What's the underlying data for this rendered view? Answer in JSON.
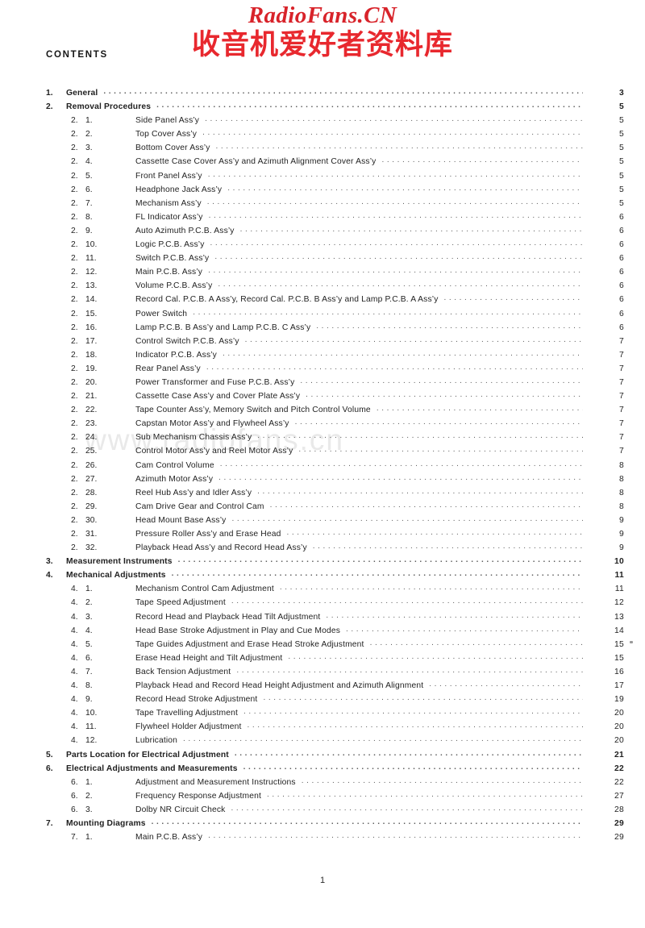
{
  "watermark": {
    "latin": "RadioFans.CN",
    "cjk": "收音机爱好者资料库",
    "faint": "www.radiofans.cn",
    "latin_color": "#d8232a",
    "cjk_color": "#e8282e",
    "faint_color": "#e9e9e9"
  },
  "heading": "CONTENTS",
  "folio": "1",
  "toc": [
    {
      "level": 1,
      "a": "1.",
      "b": "",
      "label": "General",
      "page": "3"
    },
    {
      "level": 1,
      "a": "2.",
      "b": "",
      "label": "Removal Procedures",
      "page": "5"
    },
    {
      "level": 2,
      "a": "2.",
      "b": "1.",
      "label": "Side Panel Ass’y",
      "page": "5"
    },
    {
      "level": 2,
      "a": "2.",
      "b": "2.",
      "label": "Top Cover Ass’y",
      "page": "5"
    },
    {
      "level": 2,
      "a": "2.",
      "b": "3.",
      "label": "Bottom Cover Ass’y",
      "page": "5"
    },
    {
      "level": 2,
      "a": "2.",
      "b": "4.",
      "label": "Cassette Case Cover Ass’y and Azimuth Alignment Cover Ass’y",
      "page": "5"
    },
    {
      "level": 2,
      "a": "2.",
      "b": "5.",
      "label": "Front Panel Ass’y",
      "page": "5"
    },
    {
      "level": 2,
      "a": "2.",
      "b": "6.",
      "label": "Headphone Jack Ass’y",
      "page": "5"
    },
    {
      "level": 2,
      "a": "2.",
      "b": "7.",
      "label": "Mechanism Ass’y",
      "page": "5"
    },
    {
      "level": 2,
      "a": "2.",
      "b": "8.",
      "label": "FL Indicator Ass’y",
      "page": "6"
    },
    {
      "level": 2,
      "a": "2.",
      "b": "9.",
      "label": "Auto Azimuth P.C.B. Ass’y",
      "page": "6"
    },
    {
      "level": 2,
      "a": "2.",
      "b": "10.",
      "label": "Logic P.C.B. Ass’y",
      "page": "6"
    },
    {
      "level": 2,
      "a": "2.",
      "b": "11.",
      "label": "Switch P.C.B. Ass’y",
      "page": "6"
    },
    {
      "level": 2,
      "a": "2.",
      "b": "12.",
      "label": "Main P.C.B. Ass’y",
      "page": "6"
    },
    {
      "level": 2,
      "a": "2.",
      "b": "13.",
      "label": "Volume P.C.B. Ass’y",
      "page": "6"
    },
    {
      "level": 2,
      "a": "2.",
      "b": "14.",
      "label": "Record Cal. P.C.B. A Ass’y, Record Cal. P.C.B. B Ass’y and Lamp P.C.B. A Ass’y",
      "page": "6"
    },
    {
      "level": 2,
      "a": "2.",
      "b": "15.",
      "label": "Power Switch",
      "page": "6"
    },
    {
      "level": 2,
      "a": "2.",
      "b": "16.",
      "label": "Lamp P.C.B. B Ass’y and Lamp P.C.B. C Ass’y",
      "page": "6"
    },
    {
      "level": 2,
      "a": "2.",
      "b": "17.",
      "label": "Control Switch P.C.B. Ass’y",
      "page": "7"
    },
    {
      "level": 2,
      "a": "2.",
      "b": "18.",
      "label": "Indicator P.C.B. Ass’y",
      "page": "7"
    },
    {
      "level": 2,
      "a": "2.",
      "b": "19.",
      "label": "Rear Panel Ass’y",
      "page": "7"
    },
    {
      "level": 2,
      "a": "2.",
      "b": "20.",
      "label": "Power Transformer and Fuse P.C.B. Ass’y",
      "page": "7"
    },
    {
      "level": 2,
      "a": "2.",
      "b": "21.",
      "label": "Cassette Case Ass’y and Cover Plate Ass’y",
      "page": "7"
    },
    {
      "level": 2,
      "a": "2.",
      "b": "22.",
      "label": "Tape Counter Ass’y, Memory Switch and Pitch Control Volume",
      "page": "7"
    },
    {
      "level": 2,
      "a": "2.",
      "b": "23.",
      "label": "Capstan Motor Ass’y and Flywheel Ass’y",
      "page": "7"
    },
    {
      "level": 2,
      "a": "2.",
      "b": "24.",
      "label": "Sub Mechanism Chassis Ass’y",
      "page": "7"
    },
    {
      "level": 2,
      "a": "2.",
      "b": "25.",
      "label": "Control Motor Ass’y and Reel Motor Ass’y",
      "page": "7"
    },
    {
      "level": 2,
      "a": "2.",
      "b": "26.",
      "label": "Cam Control Volume",
      "page": "8"
    },
    {
      "level": 2,
      "a": "2.",
      "b": "27.",
      "label": "Azimuth Motor Ass’y",
      "page": "8"
    },
    {
      "level": 2,
      "a": "2.",
      "b": "28.",
      "label": "Reel Hub Ass’y and Idler Ass’y",
      "page": "8"
    },
    {
      "level": 2,
      "a": "2.",
      "b": "29.",
      "label": "Cam Drive Gear and Control Cam",
      "page": "8"
    },
    {
      "level": 2,
      "a": "2.",
      "b": "30.",
      "label": "Head Mount Base Ass’y",
      "page": "9"
    },
    {
      "level": 2,
      "a": "2.",
      "b": "31.",
      "label": "Pressure Roller Ass’y and Erase Head",
      "page": "9"
    },
    {
      "level": 2,
      "a": "2.",
      "b": "32.",
      "label": "Playback Head Ass’y and Record Head Ass’y",
      "page": "9"
    },
    {
      "level": 1,
      "a": "3.",
      "b": "",
      "label": "Measurement Instruments",
      "page": "10"
    },
    {
      "level": 1,
      "a": "4.",
      "b": "",
      "label": "Mechanical Adjustments",
      "page": "11"
    },
    {
      "level": 2,
      "a": "4.",
      "b": "1.",
      "label": "Mechanism Control Cam Adjustment",
      "page": "11"
    },
    {
      "level": 2,
      "a": "4.",
      "b": "2.",
      "label": "Tape Speed Adjustment",
      "page": "12"
    },
    {
      "level": 2,
      "a": "4.",
      "b": "3.",
      "label": "Record Head and Playback Head Tilt Adjustment",
      "page": "13"
    },
    {
      "level": 2,
      "a": "4.",
      "b": "4.",
      "label": "Head Base Stroke Adjustment in Play and Cue Modes",
      "page": "14"
    },
    {
      "level": 2,
      "a": "4.",
      "b": "5.",
      "label": "Tape Guides Adjustment and Erase Head Stroke Adjustment",
      "page": "15"
    },
    {
      "level": 2,
      "a": "4.",
      "b": "6.",
      "label": "Erase Head Height and Tilt Adjustment",
      "page": "15"
    },
    {
      "level": 2,
      "a": "4.",
      "b": "7.",
      "label": "Back Tension Adjustment",
      "page": "16"
    },
    {
      "level": 2,
      "a": "4.",
      "b": "8.",
      "label": "Playback Head and Record Head Height Adjustment and Azimuth Alignment",
      "page": "17"
    },
    {
      "level": 2,
      "a": "4.",
      "b": "9.",
      "label": "Record Head Stroke Adjustment",
      "page": "19"
    },
    {
      "level": 2,
      "a": "4.",
      "b": "10.",
      "label": "Tape Travelling Adjustment",
      "page": "20"
    },
    {
      "level": 2,
      "a": "4.",
      "b": "11.",
      "label": "Flywheel Holder Adjustment",
      "page": "20"
    },
    {
      "level": 2,
      "a": "4.",
      "b": "12.",
      "label": "Lubrication",
      "page": "20"
    },
    {
      "level": 1,
      "a": "5.",
      "b": "",
      "label": "Parts Location for Electrical Adjustment",
      "page": "21"
    },
    {
      "level": 1,
      "a": "6.",
      "b": "",
      "label": "Electrical Adjustments and Measurements",
      "page": "22"
    },
    {
      "level": 2,
      "a": "6.",
      "b": "1.",
      "label": "Adjustment and Measurement Instructions",
      "page": "22"
    },
    {
      "level": 2,
      "a": "6.",
      "b": "2.",
      "label": "Frequency Response Adjustment",
      "page": "27"
    },
    {
      "level": 2,
      "a": "6.",
      "b": "3.",
      "label": "Dolby NR Circuit Check",
      "page": "28"
    },
    {
      "level": 1,
      "a": "7.",
      "b": "",
      "label": "Mounting Diagrams",
      "page": "29"
    },
    {
      "level": 2,
      "a": "7.",
      "b": "1.",
      "label": "Main P.C.B. Ass’y",
      "page": "29"
    }
  ]
}
